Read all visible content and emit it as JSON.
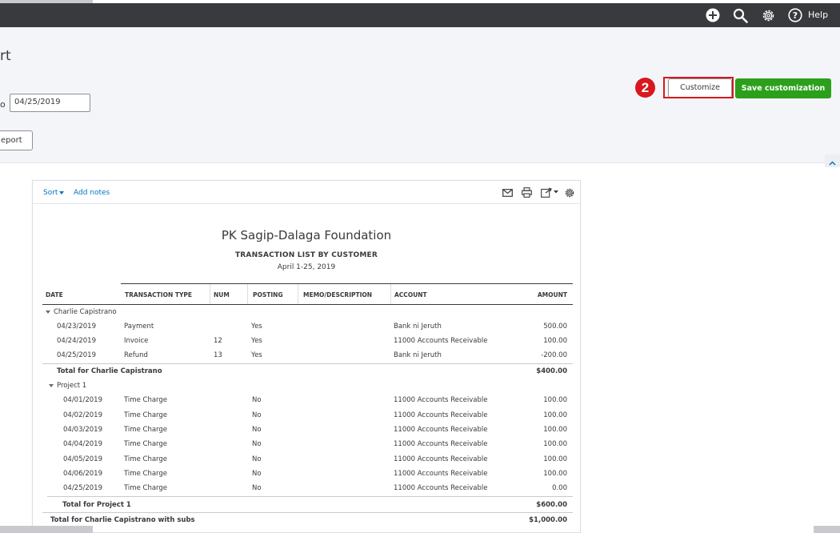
{
  "header": {
    "title_fragment": "rt",
    "date_separator": "o",
    "end_date": "04/25/2019",
    "run_report_label": "eport",
    "customize_label": "Customize",
    "save_label": "Save customization",
    "step_number": "2",
    "help_label": "Help"
  },
  "icons": [
    "plus-circle-icon",
    "search-icon",
    "gear-icon",
    "help-icon",
    "mail-icon",
    "print-icon",
    "export-icon",
    "gear-icon",
    "chevron-up-icon"
  ],
  "colors": {
    "topbar": "#393a3d",
    "accent_green": "#2ca01c",
    "highlight_red": "#d8181e",
    "link_blue": "#0077c5"
  },
  "report": {
    "toolbar": {
      "sort_label": "Sort",
      "notes_label": "Add notes"
    },
    "company": "PK Sagip-Dalaga Foundation",
    "title": "TRANSACTION LIST BY CUSTOMER",
    "period": "April 1-25, 2019",
    "columns": {
      "date": "DATE",
      "type": "TRANSACTION TYPE",
      "num": "NUM",
      "posting": "POSTING",
      "memo": "MEMO/DESCRIPTION",
      "account": "ACCOUNT",
      "amount": "AMOUNT"
    },
    "group1": {
      "name": "Charlie Capistrano",
      "rows": [
        {
          "date": "04/23/2019",
          "type": "Payment",
          "num": "",
          "posting": "Yes",
          "account": "Bank ni Jeruth",
          "amount": "500.00"
        },
        {
          "date": "04/24/2019",
          "type": "Invoice",
          "num": "12",
          "posting": "Yes",
          "account": "11000 Accounts Receivable",
          "amount": "100.00"
        },
        {
          "date": "04/25/2019",
          "type": "Refund",
          "num": "13",
          "posting": "Yes",
          "account": "Bank ni Jeruth",
          "amount": "-200.00"
        }
      ],
      "total_label": "Total for Charlie Capistrano",
      "total": "$400.00"
    },
    "group2": {
      "name": "Project 1",
      "rows": [
        {
          "date": "04/01/2019",
          "type": "Time Charge",
          "posting": "No",
          "account": "11000 Accounts Receivable",
          "amount": "100.00"
        },
        {
          "date": "04/02/2019",
          "type": "Time Charge",
          "posting": "No",
          "account": "11000 Accounts Receivable",
          "amount": "100.00"
        },
        {
          "date": "04/03/2019",
          "type": "Time Charge",
          "posting": "No",
          "account": "11000 Accounts Receivable",
          "amount": "100.00"
        },
        {
          "date": "04/04/2019",
          "type": "Time Charge",
          "posting": "No",
          "account": "11000 Accounts Receivable",
          "amount": "100.00"
        },
        {
          "date": "04/05/2019",
          "type": "Time Charge",
          "posting": "No",
          "account": "11000 Accounts Receivable",
          "amount": "100.00"
        },
        {
          "date": "04/06/2019",
          "type": "Time Charge",
          "posting": "No",
          "account": "11000 Accounts Receivable",
          "amount": "100.00"
        },
        {
          "date": "04/25/2019",
          "type": "Time Charge",
          "posting": "No",
          "account": "11000 Accounts Receivable",
          "amount": "0.00"
        }
      ],
      "total_label": "Total for Project 1",
      "total": "$600.00"
    },
    "grand_total_label": "Total for Charlie Capistrano with subs",
    "grand_total": "$1,000.00"
  }
}
